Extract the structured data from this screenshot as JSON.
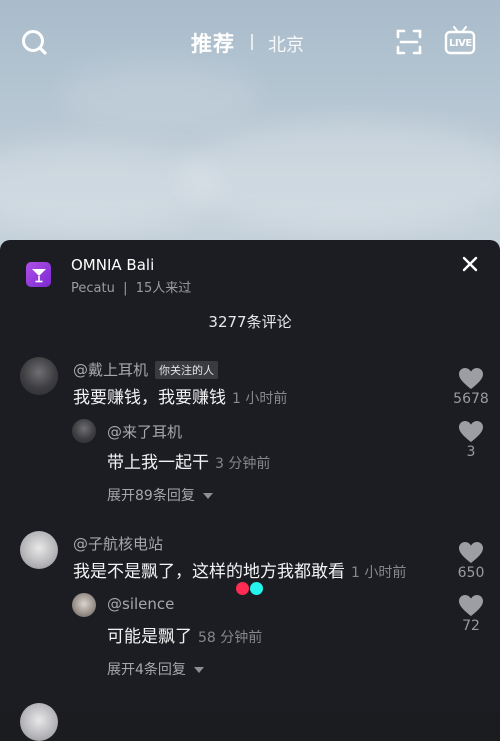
{
  "header": {
    "tab_recommend": "推荐",
    "tab_city": "北京",
    "search_icon": "search-icon",
    "scan_icon": "scan-icon",
    "live_icon": "live-icon",
    "live_label": "LIVE"
  },
  "venue": {
    "name": "OMNIA Bali",
    "location": "Pecatu",
    "separator": "|",
    "visitors": "15人来过",
    "icon": "cocktail-icon"
  },
  "comments_count": "3277条评论",
  "comments": [
    {
      "user": "@戴上耳机",
      "badge": "你关注的人",
      "text": "我要赚钱，我要赚钱",
      "time": "1 小时前",
      "likes": "5678",
      "reply": {
        "user": "@来了耳机",
        "text": "带上我一起干",
        "time": "3 分钟前",
        "likes": "3"
      },
      "expand": "展开89条回复"
    },
    {
      "user": "@子航核电站",
      "text": "我是不是飘了，这样的地方我都敢看",
      "time": "1 小时前",
      "likes": "650",
      "reply": {
        "user": "@silence",
        "text": "可能是飘了",
        "time": "58 分钟前",
        "likes": "72"
      },
      "expand": "展开4条回复"
    }
  ],
  "colors": {
    "panel": "#1c1d22",
    "accent_purple": "#9b3fe0",
    "dot_red": "#fe2c55",
    "dot_cyan": "#25f4ee"
  }
}
